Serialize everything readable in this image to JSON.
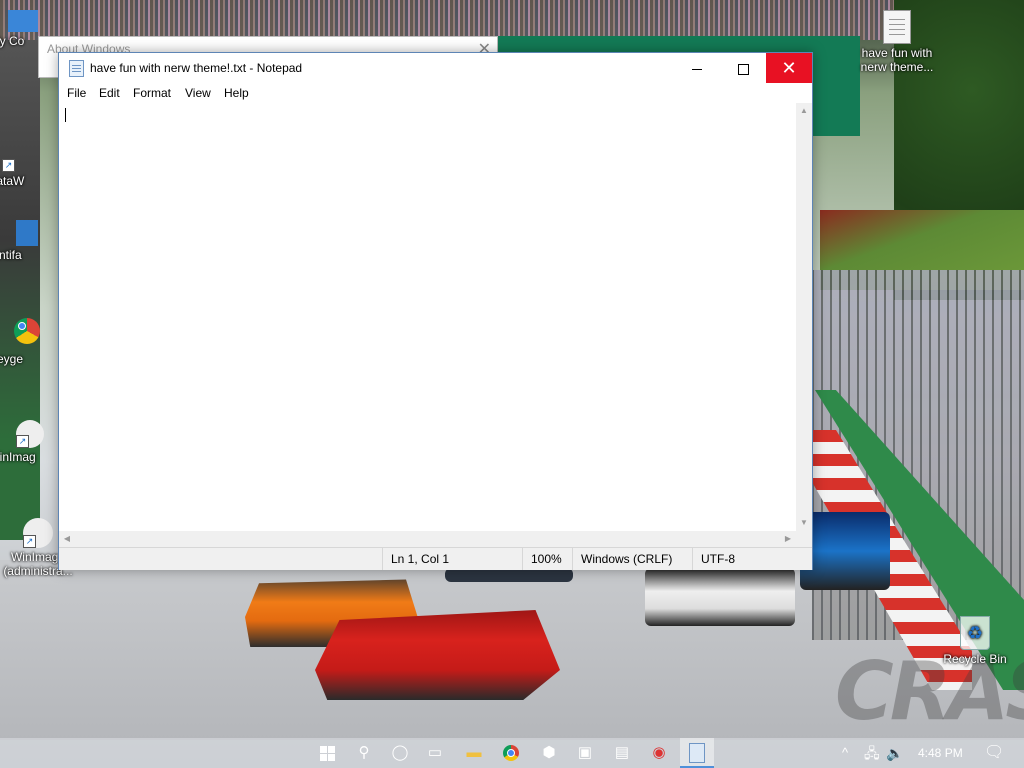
{
  "desktop": {
    "icons": [
      {
        "label": "My Co",
        "name": "my-computer"
      },
      {
        "label": "DataW",
        "name": "dataw"
      },
      {
        "label": "antifa",
        "name": "antifa"
      },
      {
        "label": "keyge",
        "name": "keygen"
      },
      {
        "label": "WinImag",
        "name": "winimage"
      },
      {
        "label": "WinImage (administra...",
        "name": "winimage-admin"
      },
      {
        "label": "have fun with nerw theme...",
        "name": "have-fun-file"
      },
      {
        "label": "Recycle Bin",
        "name": "recycle-bin"
      }
    ],
    "wallpaper_watermark": "CRASH"
  },
  "about_window": {
    "title": "About Windows",
    "close_glyph": "✕"
  },
  "notepad": {
    "title": "have fun with nerw theme!.txt - Notepad",
    "controls": {
      "minimize": "",
      "maximize": "",
      "close": "✕"
    },
    "menu": [
      "File",
      "Edit",
      "Format",
      "View",
      "Help"
    ],
    "content": "",
    "status": {
      "position": "Ln 1, Col 1",
      "zoom": "100%",
      "line_endings": "Windows (CRLF)",
      "encoding": "UTF-8"
    }
  },
  "taskbar": {
    "apps": [
      "start",
      "search",
      "cortana",
      "task-view",
      "file-explorer",
      "chrome",
      "package",
      "remote",
      "app",
      "compass",
      "notepad"
    ],
    "tray": {
      "chevron": "^",
      "time": "4:48 PM"
    }
  },
  "colors": {
    "close_red": "#e81123",
    "accent_blue": "#4f90d9"
  }
}
